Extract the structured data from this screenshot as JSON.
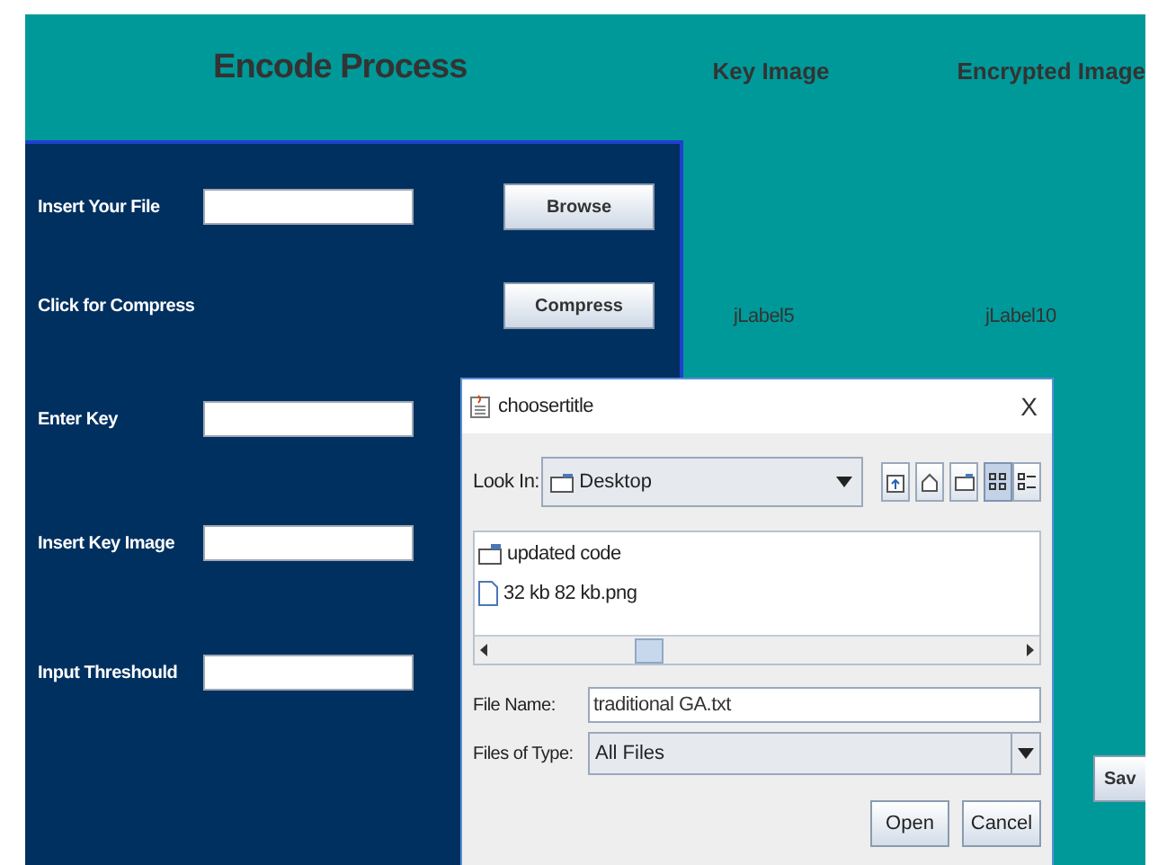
{
  "app": {
    "title": "Encode Process",
    "columns": [
      "Key Image",
      "Encrypted Image"
    ],
    "image_labels": [
      "jLabel5",
      "jLabel10"
    ],
    "form": [
      {
        "kind": "field_button",
        "label": "Insert Your File",
        "button": "Browse"
      },
      {
        "kind": "button",
        "label": "Click for Compress",
        "button": "Compress"
      },
      {
        "kind": "field",
        "label": "Enter Key"
      },
      {
        "kind": "field",
        "label": "Insert Key Image"
      },
      {
        "kind": "field",
        "label": "Input Threshould"
      }
    ],
    "side_button": "Sav"
  },
  "dialog": {
    "title": "choosertitle",
    "close": "X",
    "look_in": {
      "label": "Look In:",
      "value": "Desktop"
    },
    "view_buttons": [
      {
        "kind": "list",
        "selected": true
      },
      {
        "kind": "details",
        "selected": false
      }
    ],
    "files": [
      {
        "kind": "folder",
        "name": "updated code"
      },
      {
        "kind": "file",
        "name": "32 kb 82 kb.png"
      }
    ],
    "file_name": {
      "label": "File Name:",
      "value": "traditional GA.txt"
    },
    "file_type": {
      "label": "Files of Type:",
      "value": "All Files"
    },
    "buttons": [
      "Open",
      "Cancel"
    ]
  }
}
